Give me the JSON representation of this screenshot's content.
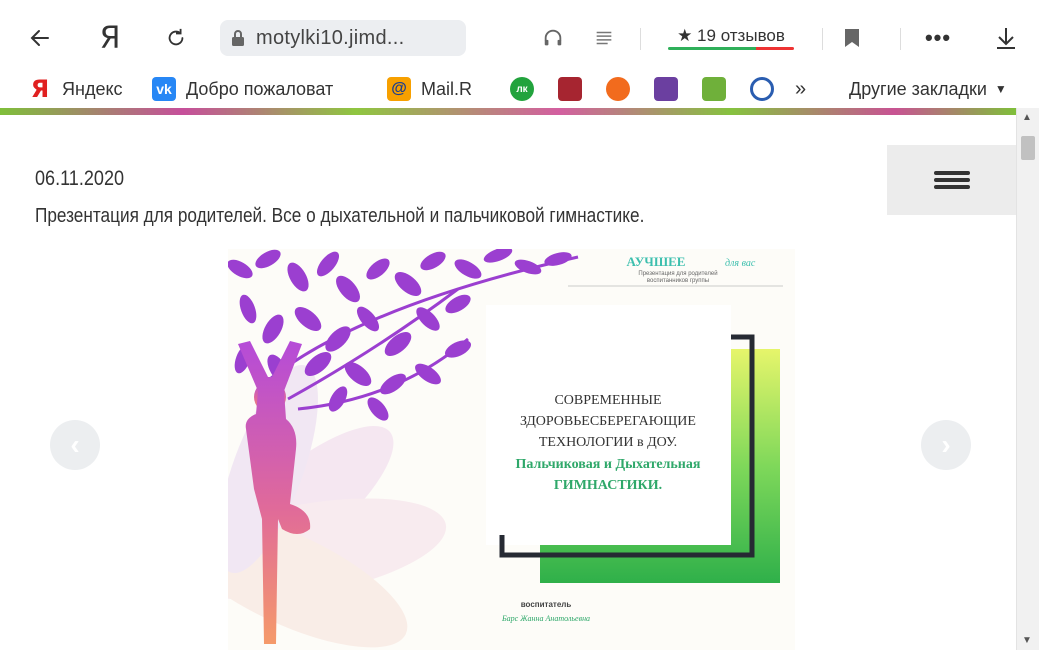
{
  "browser": {
    "address_url": "motylki10.jimd...",
    "reviews_label": "★ 19 отзывов",
    "bookmarks": [
      {
        "label": "Яндекс",
        "icon": "yandex-icon"
      },
      {
        "label": "Добро пожаловат",
        "icon": "vk-icon"
      },
      {
        "label": "Mail.R",
        "icon": "mail-ru-icon"
      }
    ],
    "more_bookmarks_label": "»",
    "other_bookmarks_label": "Другие закладки",
    "colors": {
      "reviews_green": "#2fb05a",
      "reviews_red": "#ee3333",
      "yandex_red": "#e02020",
      "vk_blue": "#2787f5"
    }
  },
  "page": {
    "date": "06.11.2020",
    "title": "Презентация для родителей. Все о дыхательной и пальчиковой гимнастике."
  },
  "slide": {
    "brand_title": "АУЧШЕЕ",
    "brand_suffix": "для вас",
    "brand_subtitle_1": "Презентация для родителей",
    "brand_subtitle_2": "воспитанников группы",
    "heading_line_1": "СОВРЕМЕННЫЕ",
    "heading_line_2": "ЗДОРОВЬЕСБЕРЕГАЮЩИЕ",
    "heading_line_3": "ТЕХНОЛОГИИ в ДОУ.",
    "subheading_line_1": "Пальчиковая и Дыхательная",
    "subheading_line_2": "ГИМНАСТИКИ.",
    "author_role": "воспитатель",
    "author_name": "Барс Жанна Анатольевна"
  }
}
